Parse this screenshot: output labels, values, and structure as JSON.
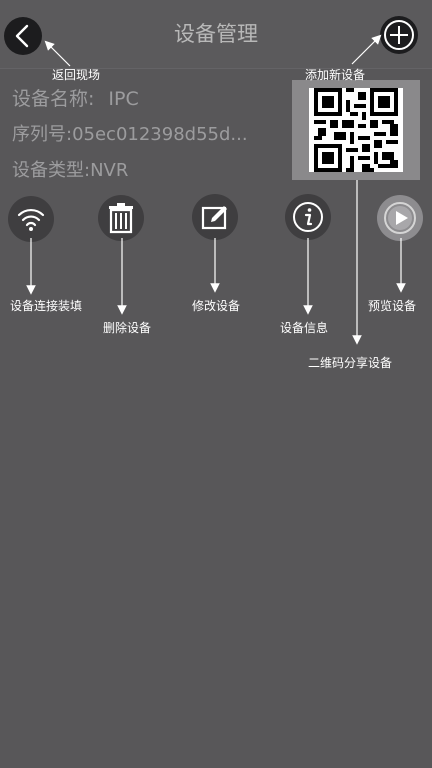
{
  "header": {
    "title": "设备管理",
    "back_icon": "chevron-left-icon",
    "add_icon": "plus-circle-icon"
  },
  "device": {
    "name_label": "设备名称:",
    "name_value": "IPC",
    "serial_text": "序列号:05ec012398d55d...",
    "type_text": "设备类型:NVR"
  },
  "actions": [
    {
      "icon": "wifi-icon",
      "label": "设备连接装填"
    },
    {
      "icon": "trash-icon",
      "label": "删除设备"
    },
    {
      "icon": "edit-icon",
      "label": "修改设备"
    },
    {
      "icon": "info-icon",
      "label": "设备信息"
    },
    {
      "icon": "play-icon",
      "label": "预览设备"
    }
  ],
  "annotations": {
    "back": "返回现场",
    "add": "添加新设备",
    "qr": "二维码分享设备"
  },
  "colors": {
    "background": "#585759",
    "button_bg": "#1c1c1e",
    "text_muted": "#9c9c9e"
  }
}
